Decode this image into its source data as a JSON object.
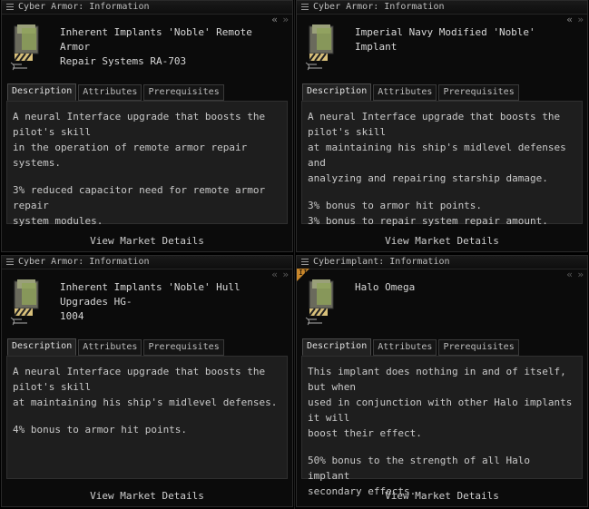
{
  "windows": [
    {
      "title": "Cyber Armor: Information",
      "name": "Inherent Implants 'Noble' Remote Armor\nRepair Systems RA-703",
      "tabs": [
        "Description",
        "Attributes",
        "Prerequisites"
      ],
      "active_tab": "Description",
      "description": [
        "A neural Interface upgrade that boosts the pilot's skill\nin the operation of remote armor repair systems.",
        "3% reduced capacitor need for remote armor repair\nsystem modules."
      ],
      "footer": "View Market Details",
      "nav_back": "«",
      "nav_forward": "»"
    },
    {
      "title": "Cyber Armor: Information",
      "name": "Imperial Navy Modified 'Noble' Implant",
      "tabs": [
        "Description",
        "Attributes",
        "Prerequisites"
      ],
      "active_tab": "Description",
      "description": [
        "A neural Interface upgrade that boosts the pilot's skill\nat maintaining his ship's midlevel defenses and\nanalyzing and repairing starship damage.",
        "3% bonus to armor hit points.\n3% bonus to repair system repair amount."
      ],
      "footer": "View Market Details",
      "nav_back": "«",
      "nav_forward": "»"
    },
    {
      "title": "Cyber Armor: Information",
      "name": "Inherent Implants 'Noble' Hull Upgrades HG-\n1004",
      "tabs": [
        "Description",
        "Attributes",
        "Prerequisites"
      ],
      "active_tab": "Description",
      "description": [
        "A neural Interface upgrade that boosts the pilot's skill\nat maintaining his ship's midlevel defenses.",
        "4% bonus to armor hit points."
      ],
      "footer": "View Market Details",
      "nav_back": "«",
      "nav_forward": "»"
    },
    {
      "title": "Cyberimplant: Information",
      "name": "Halo Omega",
      "tabs": [
        "Description",
        "Attributes",
        "Prerequisites"
      ],
      "active_tab": "Description",
      "description": [
        "This implant does nothing in and of itself, but when\nused in conjunction with other Halo implants it will\nboost their effect.",
        "50% bonus to the strength of all Halo implant\nsecondary effects."
      ],
      "footer": "View Market Details",
      "nav_back": "«",
      "nav_forward": "»",
      "corner_badge": "II"
    }
  ],
  "icons": {
    "menu": "hamburger-menu-icon",
    "item": "implant-icon",
    "badge": "meta-level-badge"
  },
  "colors": {
    "background": "#000000",
    "panel": "#1e1e1e",
    "badge": "#c8862a"
  }
}
